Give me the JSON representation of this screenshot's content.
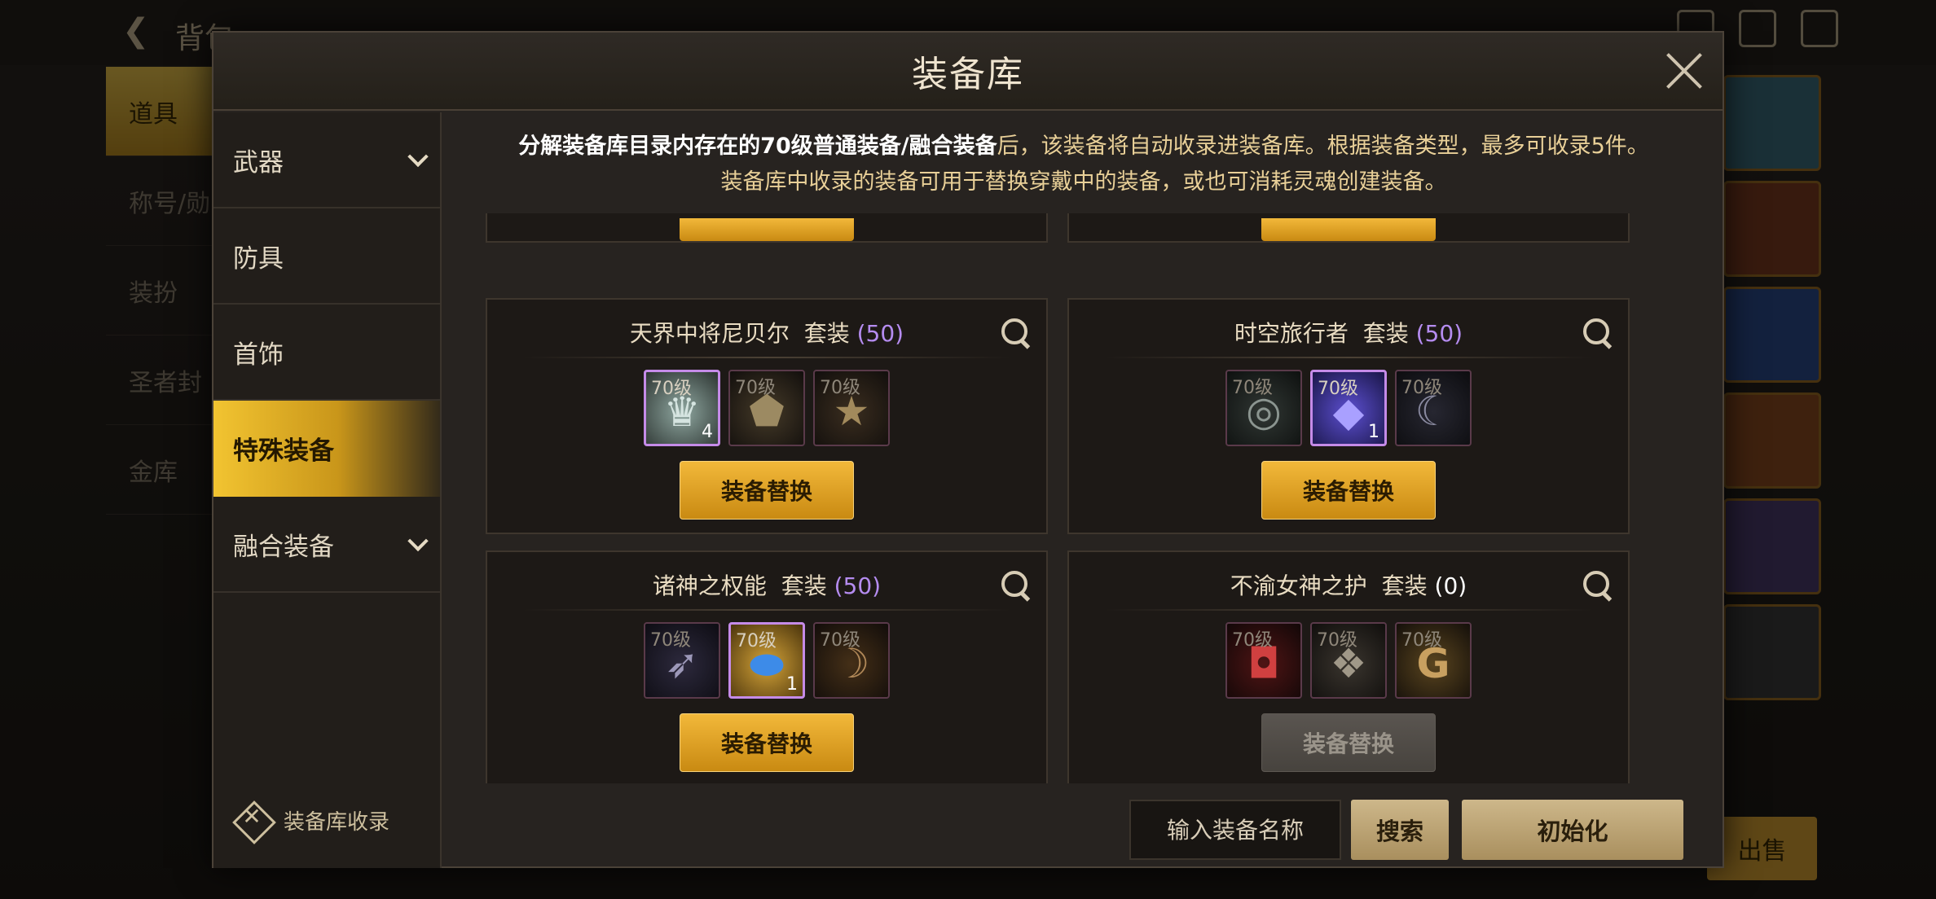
{
  "background": {
    "title": "背包",
    "tabs": [
      "道具",
      "称号/勋",
      "装扮",
      "圣者封",
      "金库"
    ],
    "sell_label": "出售"
  },
  "modal": {
    "title": "装备库",
    "notice_line1_highlight": "分解装备库目录内存在的70级普通装备/融合装备",
    "notice_line1_rest": "后，该装备将自动收录进装备库。根据装备类型，最多可收录5件。",
    "notice_line2": "装备库中收录的装备可用于替换穿戴中的装备，或也可消耗灵魂创建装备。"
  },
  "sidebar": {
    "items": [
      {
        "label": "武器",
        "has_chevron": true
      },
      {
        "label": "防具",
        "has_chevron": false
      },
      {
        "label": "首饰",
        "has_chevron": false
      },
      {
        "label": "特殊装备",
        "has_chevron": false,
        "active": true
      },
      {
        "label": "融合装备",
        "has_chevron": true
      }
    ],
    "footer_label": "装备库收录"
  },
  "cards": [
    {
      "name": "天界中将尼贝尔",
      "suffix": "套装",
      "count": "(50)",
      "button": "装备替换",
      "button_enabled": true,
      "slots": [
        {
          "level": "70级",
          "owned": true,
          "count": "4",
          "icon": "crown-icon"
        },
        {
          "level": "70级",
          "owned": false,
          "count": "",
          "icon": "amulet-icon"
        },
        {
          "level": "70级",
          "owned": false,
          "count": "",
          "icon": "stars-icon"
        }
      ]
    },
    {
      "name": "时空旅行者",
      "suffix": "套装",
      "count": "(50)",
      "button": "装备替换",
      "button_enabled": true,
      "slots": [
        {
          "level": "70级",
          "owned": false,
          "count": "",
          "icon": "bracelet-icon"
        },
        {
          "level": "70级",
          "owned": true,
          "count": "1",
          "icon": "gem-icon"
        },
        {
          "level": "70级",
          "owned": false,
          "count": "",
          "icon": "ring-icon"
        }
      ]
    },
    {
      "name": "诸神之权能",
      "suffix": "套装",
      "count": "(50)",
      "button": "装备替换",
      "button_enabled": true,
      "slots": [
        {
          "level": "70级",
          "owned": false,
          "count": "",
          "icon": "feather-icon"
        },
        {
          "level": "70级",
          "owned": true,
          "count": "1",
          "icon": "sapphire-icon"
        },
        {
          "level": "70级",
          "owned": false,
          "count": "",
          "icon": "horn-icon"
        }
      ]
    },
    {
      "name": "不渝女神之护",
      "suffix": "套装",
      "count": "(0)",
      "button": "装备替换",
      "button_enabled": false,
      "slots": [
        {
          "level": "70级",
          "owned": false,
          "count": "",
          "icon": "amulet-red-icon"
        },
        {
          "level": "70级",
          "owned": false,
          "count": "",
          "icon": "knot-icon"
        },
        {
          "level": "70级",
          "owned": false,
          "count": "",
          "icon": "emblem-icon"
        }
      ]
    }
  ],
  "bottom": {
    "search_placeholder": "输入装备名称",
    "search_button": "搜索",
    "reset_button": "初始化"
  },
  "colors": {
    "accent_gold": "#f2b83a",
    "owned_border": "#c58be8",
    "count_purple": "#b58cf0"
  }
}
